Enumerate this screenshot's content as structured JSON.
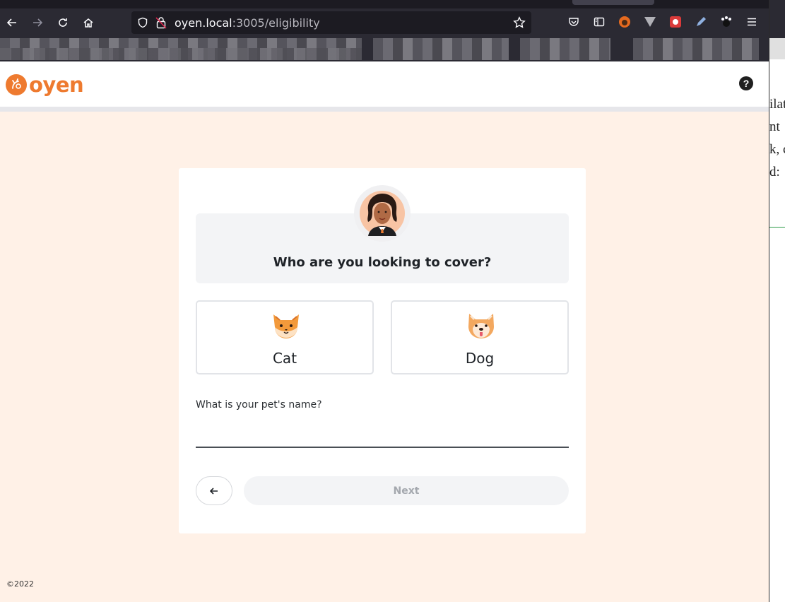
{
  "browser": {
    "url_host": "oyen.local",
    "url_path": ":3005/eligibility"
  },
  "header": {
    "logo_text": "oyen",
    "help_label": "?"
  },
  "form": {
    "question": "Who are you looking to cover?",
    "options": [
      {
        "label": "Cat"
      },
      {
        "label": "Dog"
      }
    ],
    "pet_name_label": "What is your pet's name?",
    "pet_name_value": "",
    "next_label": "Next"
  },
  "footer": {
    "copyright": "©2022"
  },
  "overflow_fragments": [
    "ilat",
    "nt",
    "k, c",
    "d:"
  ],
  "colors": {
    "brand": "#ee7a2f",
    "page_bg": "#fff1e7",
    "card_bg": "#ffffff",
    "question_box_bg": "#f3f4f6",
    "next_disabled_bg": "#f3f4f6"
  }
}
